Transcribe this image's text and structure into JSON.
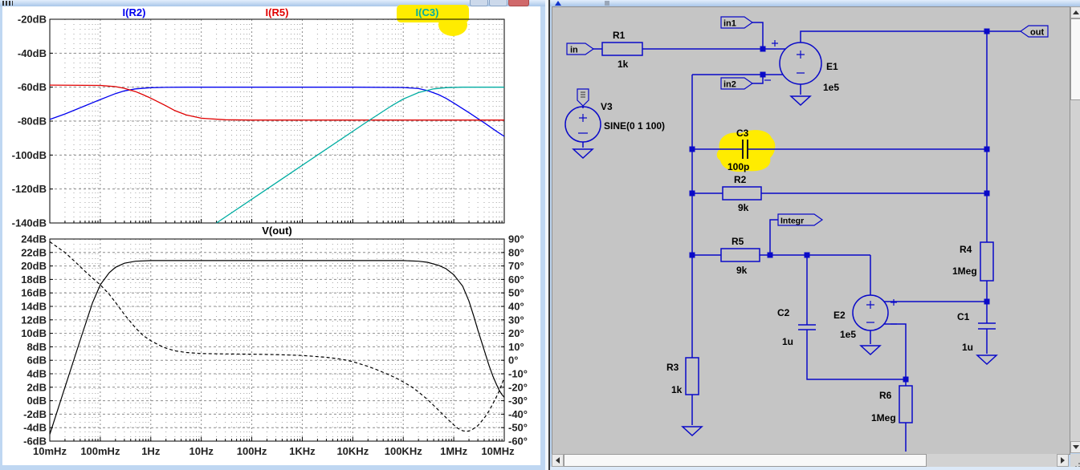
{
  "app": {
    "kind": "circuit-simulator",
    "accent_blue": "#0a0ac8",
    "canvas_gray": "#C5C5C5",
    "highlight_yellow": "#ffec00"
  },
  "chart_data": [
    {
      "type": "line",
      "title": "",
      "xlabel": "frequency",
      "xscale": "log",
      "xrange": [
        0.01,
        10000000
      ],
      "ylabel": "dB",
      "ylim": [
        -140,
        -20
      ],
      "grid": true,
      "legend_position": "top",
      "series": [
        {
          "name": "I(R2)",
          "color": "#0000EF",
          "style": "solid",
          "points": [
            [
              0.01,
              -79
            ],
            [
              0.02,
              -75.8
            ],
            [
              0.05,
              -71
            ],
            [
              0.1,
              -67.3
            ],
            [
              0.2,
              -63.8
            ],
            [
              0.3,
              -62.2
            ],
            [
              0.5,
              -61
            ],
            [
              1,
              -60.3
            ],
            [
              2,
              -60.1
            ],
            [
              5,
              -60
            ],
            [
              100,
              -60
            ],
            [
              10000,
              -60
            ],
            [
              100000,
              -60.2
            ],
            [
              200000,
              -60.8
            ],
            [
              300000,
              -62
            ],
            [
              500000,
              -64.4
            ],
            [
              700000,
              -66.6
            ],
            [
              1000000,
              -69.3
            ],
            [
              2000000,
              -75
            ],
            [
              4000000,
              -81
            ],
            [
              7000000,
              -86
            ],
            [
              10000000,
              -89
            ]
          ]
        },
        {
          "name": "I(R5)",
          "color": "#E00000",
          "style": "solid",
          "points": [
            [
              0.01,
              -58.8
            ],
            [
              0.1,
              -59
            ],
            [
              0.2,
              -59.7
            ],
            [
              0.3,
              -60.7
            ],
            [
              0.5,
              -62.6
            ],
            [
              0.7,
              -64.4
            ],
            [
              1,
              -66.5
            ],
            [
              2,
              -71
            ],
            [
              3,
              -73.8
            ],
            [
              5,
              -76.3
            ],
            [
              10,
              -78.3
            ],
            [
              30,
              -79.2
            ],
            [
              100,
              -79.4
            ],
            [
              10000000,
              -79.4
            ]
          ]
        },
        {
          "name": "I(C3)",
          "color": "#00ADA2",
          "style": "solid",
          "highlight": "#ffec00",
          "points": [
            [
              20,
              -140
            ],
            [
              200,
              -120
            ],
            [
              2000,
              -100
            ],
            [
              20000,
              -80
            ],
            [
              60000,
              -70.8
            ],
            [
              100000,
              -67
            ],
            [
              200000,
              -63.2
            ],
            [
              400000,
              -61
            ],
            [
              700000,
              -60.3
            ],
            [
              1500000,
              -60
            ],
            [
              10000000,
              -60
            ]
          ]
        }
      ]
    },
    {
      "type": "line",
      "title": "V(out)",
      "xlabel": "frequency",
      "xscale": "log",
      "xrange": [
        0.01,
        10000000
      ],
      "ylabel_left": "dB",
      "ylim_left": [
        -6,
        24
      ],
      "ylabel_right": "degrees",
      "ylim_right": [
        -60,
        90
      ],
      "grid": true,
      "series": [
        {
          "name": "V(out) magnitude",
          "axis": "left",
          "unit": "dB",
          "color": "#000000",
          "style": "solid",
          "points": [
            [
              0.01,
              -5
            ],
            [
              0.02,
              2
            ],
            [
              0.04,
              9
            ],
            [
              0.07,
              14.5
            ],
            [
              0.1,
              17.2
            ],
            [
              0.15,
              19
            ],
            [
              0.2,
              19.8
            ],
            [
              0.3,
              20.4
            ],
            [
              0.5,
              20.7
            ],
            [
              1,
              20.8
            ],
            [
              100000,
              20.8
            ],
            [
              200000,
              20.7
            ],
            [
              300000,
              20.55
            ],
            [
              500000,
              20.1
            ],
            [
              700000,
              19.6
            ],
            [
              1000000,
              18.7
            ],
            [
              1500000,
              17
            ],
            [
              2000000,
              14.8
            ],
            [
              2500000,
              12.5
            ],
            [
              3000000,
              10.5
            ],
            [
              4000000,
              7.5
            ],
            [
              5000000,
              5.2
            ],
            [
              6000000,
              3.6
            ],
            [
              7000000,
              2.4
            ],
            [
              8000000,
              1.5
            ],
            [
              9000000,
              0.9
            ],
            [
              10000000,
              0.5
            ]
          ]
        },
        {
          "name": "V(out) phase",
          "axis": "right",
          "unit": "deg",
          "color": "#000000",
          "style": "dashed",
          "points": [
            [
              0.01,
              88
            ],
            [
              0.02,
              80
            ],
            [
              0.03,
              74
            ],
            [
              0.05,
              66
            ],
            [
              0.07,
              61
            ],
            [
              0.1,
              56
            ],
            [
              0.15,
              49
            ],
            [
              0.2,
              43
            ],
            [
              0.3,
              34
            ],
            [
              0.5,
              24
            ],
            [
              0.7,
              18.5
            ],
            [
              1,
              14.5
            ],
            [
              1.5,
              11
            ],
            [
              2,
              9
            ],
            [
              3,
              7
            ],
            [
              5,
              5.8
            ],
            [
              10,
              5
            ],
            [
              30,
              4.7
            ],
            [
              100,
              4.5
            ],
            [
              300,
              4.2
            ],
            [
              1000,
              3.6
            ],
            [
              3000,
              2.2
            ],
            [
              5000,
              1.2
            ],
            [
              7000,
              0.3
            ],
            [
              10000,
              -1
            ],
            [
              20000,
              -4.5
            ],
            [
              30000,
              -7
            ],
            [
              50000,
              -10.5
            ],
            [
              70000,
              -13
            ],
            [
              100000,
              -16
            ],
            [
              150000,
              -20
            ],
            [
              200000,
              -23.5
            ],
            [
              300000,
              -29
            ],
            [
              400000,
              -33.5
            ],
            [
              500000,
              -37
            ],
            [
              700000,
              -42.5
            ],
            [
              1000000,
              -48
            ],
            [
              1200000,
              -50.5
            ],
            [
              1500000,
              -52.3
            ],
            [
              1800000,
              -52.8
            ],
            [
              2200000,
              -52
            ],
            [
              3000000,
              -48.5
            ],
            [
              4000000,
              -43
            ],
            [
              5000000,
              -37.5
            ],
            [
              6000000,
              -32
            ],
            [
              7000000,
              -27
            ],
            [
              8000000,
              -22.5
            ],
            [
              9000000,
              -17.5
            ],
            [
              10000000,
              -13
            ]
          ]
        }
      ]
    }
  ],
  "left_window": {
    "top_plot": {
      "y_tick_labels": [
        "-20dB",
        "-40dB",
        "-60dB",
        "-80dB",
        "-100dB",
        "-120dB",
        "-140dB"
      ]
    },
    "bottom_plot": {
      "title": "V(out)",
      "left_tick_labels": [
        "24dB",
        "22dB",
        "20dB",
        "18dB",
        "16dB",
        "14dB",
        "12dB",
        "10dB",
        "8dB",
        "6dB",
        "4dB",
        "2dB",
        "0dB",
        "-2dB",
        "-4dB",
        "-6dB"
      ],
      "right_tick_labels": [
        "90°",
        "80°",
        "70°",
        "60°",
        "50°",
        "40°",
        "30°",
        "20°",
        "10°",
        "0°",
        "-10°",
        "-20°",
        "-30°",
        "-40°",
        "-50°",
        "-60°"
      ],
      "x_tick_labels": [
        "10mHz",
        "100mHz",
        "1Hz",
        "10Hz",
        "100Hz",
        "1KHz",
        "10KHz",
        "100KHz",
        "1MHz",
        "10MHz"
      ]
    }
  },
  "right_window": {
    "schematic": {
      "parts": [
        {
          "id": "R1",
          "name": "R1",
          "value": "1k"
        },
        {
          "id": "R2",
          "name": "R2",
          "value": "9k"
        },
        {
          "id": "R5",
          "name": "R5",
          "value": "9k"
        },
        {
          "id": "R3",
          "name": "R3",
          "value": "1k"
        },
        {
          "id": "R4",
          "name": "R4",
          "value": "1Meg"
        },
        {
          "id": "R6",
          "name": "R6",
          "value": "1Meg"
        },
        {
          "id": "C1",
          "name": "C1",
          "value": "1u"
        },
        {
          "id": "C2",
          "name": "C2",
          "value": "1u"
        },
        {
          "id": "C3",
          "name": "C3",
          "value": "100p",
          "highlighted": true
        },
        {
          "id": "E1",
          "name": "E1",
          "value": "1e5"
        },
        {
          "id": "E2",
          "name": "E2",
          "value": "1e5"
        },
        {
          "id": "V3",
          "name": "V3",
          "value": "SINE(0 1 100)"
        }
      ],
      "ports": [
        {
          "id": "in",
          "label": "in"
        },
        {
          "id": "in1",
          "label": "in1"
        },
        {
          "id": "in2",
          "label": "in2"
        },
        {
          "id": "out",
          "label": "out"
        },
        {
          "id": "integr",
          "label": "Integr"
        }
      ]
    }
  }
}
